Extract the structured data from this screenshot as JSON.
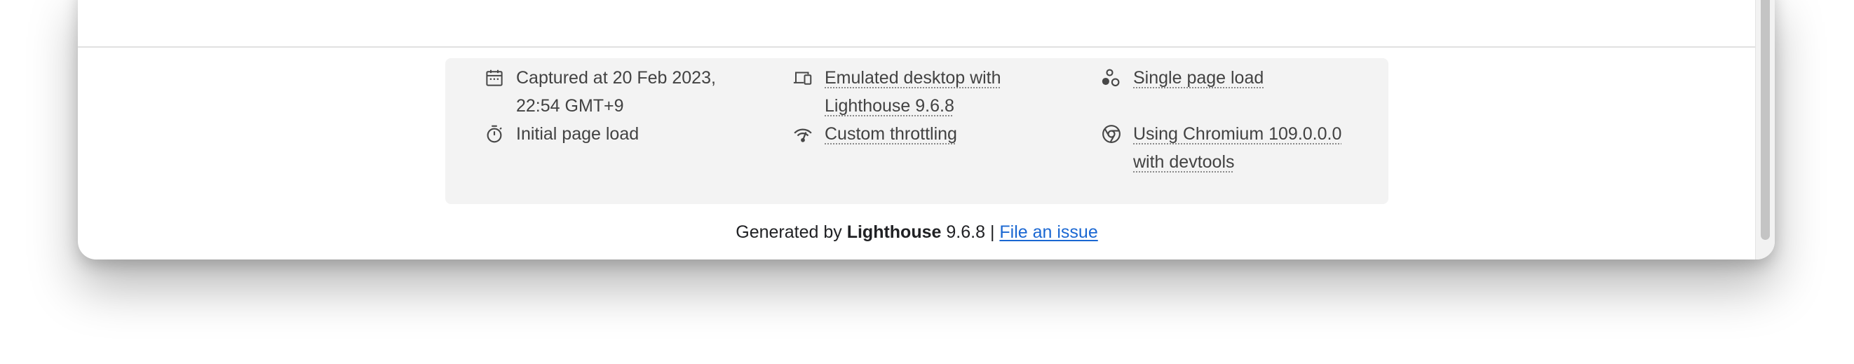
{
  "metadata": {
    "captured": "Captured at 20 Feb 2023, 22:54 GMT+9",
    "emulated": "Emulated desktop with Lighthouse 9.6.8",
    "page_load_mode": "Single page load",
    "initial_load": "Initial page load",
    "throttling": "Custom throttling",
    "browser": "Using Chromium 109.0.0.0 with devtools"
  },
  "icons": {
    "captured": "calendar-icon",
    "emulated": "devices-icon",
    "page_load_mode": "shapes-icon",
    "initial_load": "stopwatch-icon",
    "throttling": "network-gauge-icon",
    "browser": "chrome-icon"
  },
  "footer": {
    "prefix": "Generated by",
    "product": "Lighthouse",
    "version": "9.6.8",
    "separator": "|",
    "issue_link": "File an issue"
  },
  "colors": {
    "link": "#1a67d2",
    "panel_bg": "#f3f3f3",
    "text": "#424242"
  }
}
